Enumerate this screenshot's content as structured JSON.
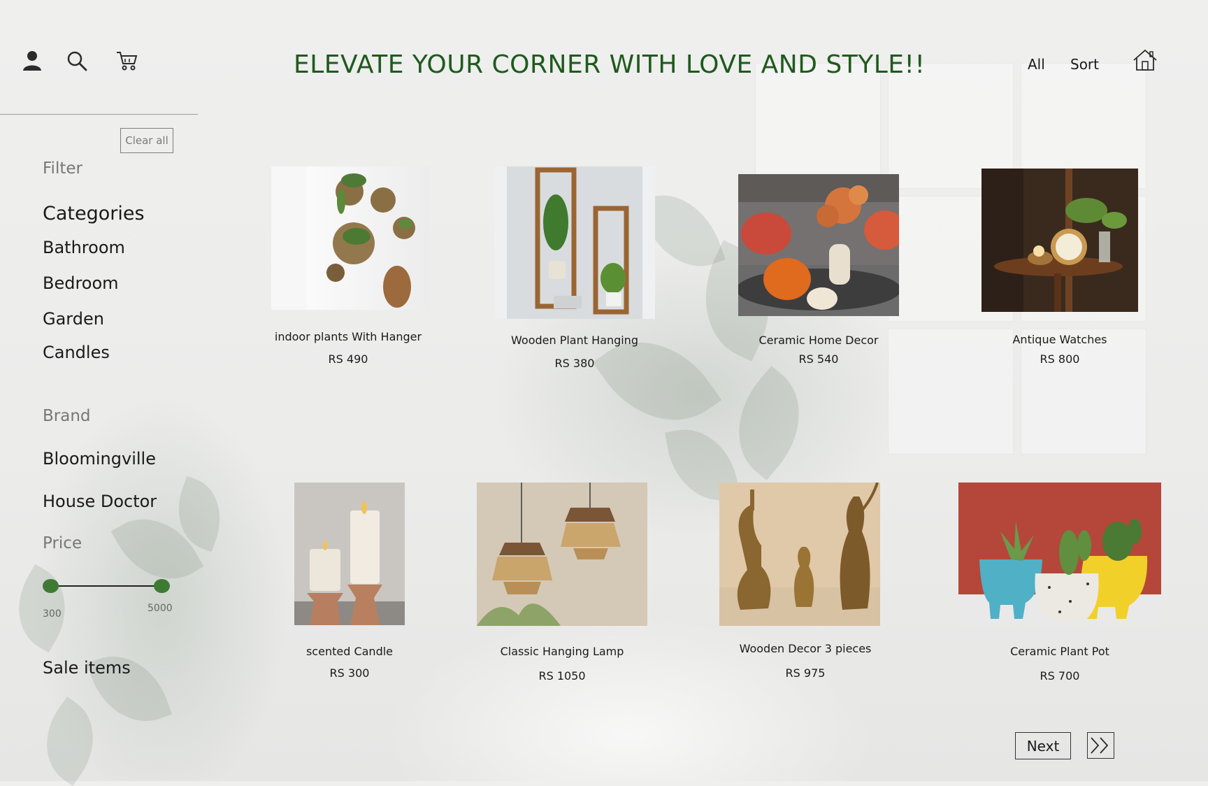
{
  "header": {
    "headline": "ELEVATE YOUR CORNER WITH LOVE AND STYLE!!",
    "icons": [
      "user-icon",
      "search-icon",
      "cart-icon",
      "home-icon"
    ],
    "nav": {
      "all": "All",
      "sort": "Sort"
    }
  },
  "sidebar": {
    "clear_all": "Clear all",
    "filter": "Filter",
    "categories_title": "Categories",
    "categories": [
      "Bathroom",
      "Bedroom",
      "Garden",
      "Candles"
    ],
    "brand_title": "Brand",
    "brands": [
      "Bloomingville",
      "House Doctor"
    ],
    "price_title": "Price",
    "price_min": "300",
    "price_max": "5000",
    "sale_items": "Sale items"
  },
  "products": [
    {
      "name": "indoor plants With Hanger",
      "price": "RS 490"
    },
    {
      "name": "Wooden Plant Hanging",
      "price": "RS 380"
    },
    {
      "name": "Ceramic Home Decor",
      "price": "RS 540"
    },
    {
      "name": "Antique Watches",
      "price": "RS 800"
    },
    {
      "name": "scented Candle",
      "price": "RS 300"
    },
    {
      "name": "Classic Hanging Lamp",
      "price": "RS 1050"
    },
    {
      "name": "Wooden Decor 3 pieces",
      "price": "RS 975"
    },
    {
      "name": "Ceramic Plant Pot",
      "price": "RS 700"
    }
  ],
  "pagination": {
    "next": "Next",
    "last_icon": "double-chevron-right-icon"
  },
  "colors": {
    "headline": "#1f5a1c",
    "slider_knob": "#3f7a34"
  }
}
